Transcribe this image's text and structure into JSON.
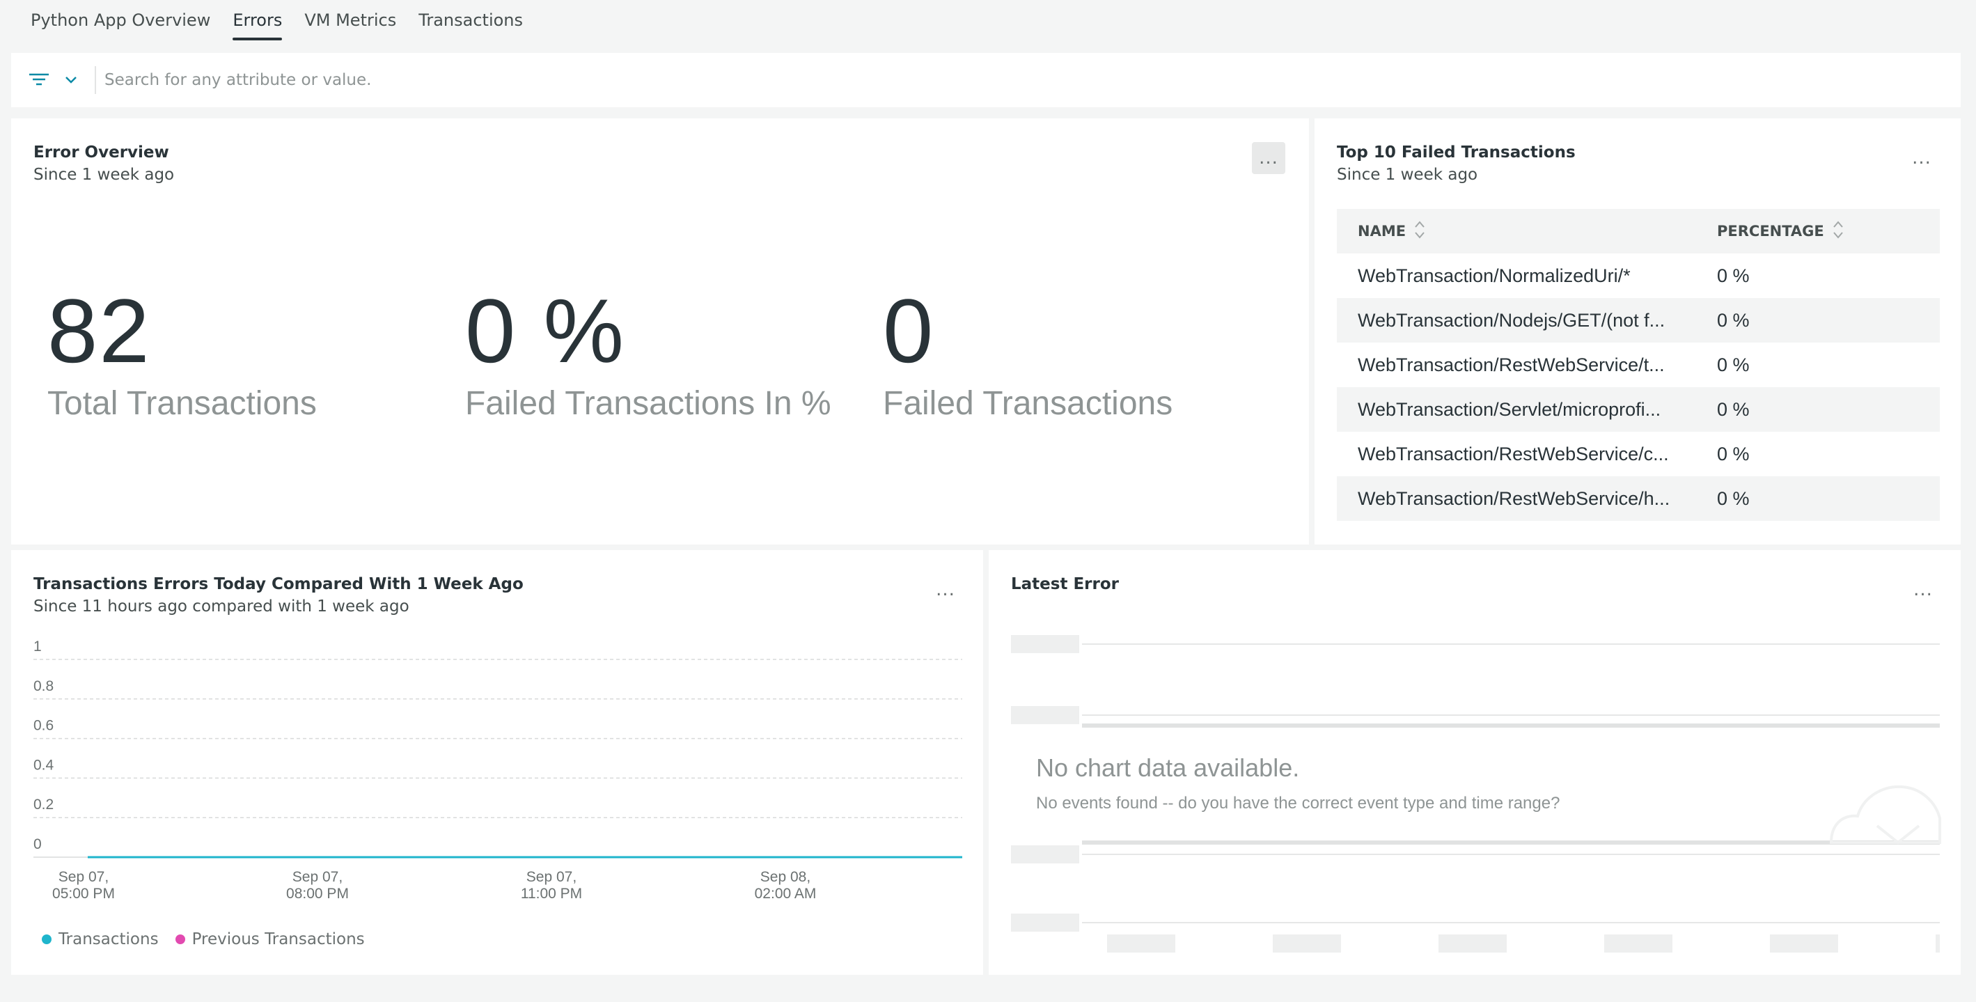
{
  "tabs": [
    {
      "label": "Python App Overview",
      "active": false
    },
    {
      "label": "Errors",
      "active": true
    },
    {
      "label": "VM Metrics",
      "active": false
    },
    {
      "label": "Transactions",
      "active": false
    }
  ],
  "filter": {
    "placeholder": "Search for any attribute or value.",
    "accent_color": "#0b8aa6"
  },
  "overview": {
    "title": "Error Overview",
    "subtitle": "Since 1 week ago",
    "menu_label": "...",
    "kpis": [
      {
        "value": "82",
        "label": "Total Transactions"
      },
      {
        "value": "0 %",
        "label": "Failed Transactions In %"
      },
      {
        "value": "0",
        "label": "Failed Transactions"
      }
    ]
  },
  "top10": {
    "title": "Top 10 Failed Transactions",
    "subtitle": "Since 1 week ago",
    "menu_label": "...",
    "columns": [
      "NAME",
      "PERCENTAGE"
    ],
    "rows": [
      {
        "name": "WebTransaction/NormalizedUri/*",
        "pct": "0 %"
      },
      {
        "name": "WebTransaction/Nodejs/GET/(not f...",
        "pct": "0 %"
      },
      {
        "name": "WebTransaction/RestWebService/t...",
        "pct": "0 %"
      },
      {
        "name": "WebTransaction/Servlet/microprofi...",
        "pct": "0 %"
      },
      {
        "name": "WebTransaction/RestWebService/c...",
        "pct": "0 %"
      },
      {
        "name": "WebTransaction/RestWebService/h...",
        "pct": "0 %"
      }
    ]
  },
  "trans_chart": {
    "title": "Transactions Errors Today Compared With 1 Week Ago",
    "subtitle": "Since 11 hours ago compared with 1 week ago",
    "menu_label": "..."
  },
  "chart_data": {
    "type": "line",
    "title": "Transactions Errors Today Compared With 1 Week Ago",
    "x_ticks": [
      [
        "Sep 07,",
        "05:00 PM"
      ],
      [
        "Sep 07,",
        "08:00 PM"
      ],
      [
        "Sep 07,",
        "11:00 PM"
      ],
      [
        "Sep 08,",
        "02:00 AM"
      ]
    ],
    "y_ticks": [
      "1",
      "0.8",
      "0.6",
      "0.4",
      "0.2",
      "0"
    ],
    "ylim": [
      0,
      1
    ],
    "grid": true,
    "legend_position": "bottom-left",
    "series": [
      {
        "name": "Transactions",
        "color": "#1fb5cc",
        "values": [
          0,
          0,
          0,
          0,
          0
        ]
      },
      {
        "name": "Previous Transactions",
        "color": "#e24ab0",
        "values": [
          0,
          0,
          0,
          0,
          0
        ]
      }
    ]
  },
  "latest_error": {
    "title": "Latest Error",
    "menu_label": "...",
    "no_data_title": "No chart data available.",
    "no_data_text": "No events found -- do you have the correct event type and time range?"
  }
}
